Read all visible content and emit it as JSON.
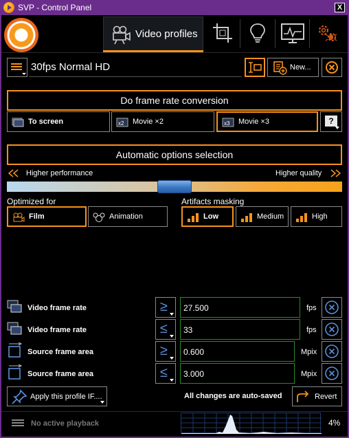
{
  "window": {
    "title": "SVP - Control Panel",
    "close_label": "X"
  },
  "toolbar": {
    "active_tab_label": "Video profiles",
    "tabs": [
      {
        "name": "video-profiles",
        "icon": "video-camera-icon"
      },
      {
        "name": "crop",
        "icon": "crop-icon"
      },
      {
        "name": "tips",
        "icon": "lightbulb-icon"
      },
      {
        "name": "monitor",
        "icon": "monitor-icon"
      },
      {
        "name": "settings",
        "icon": "gears-bug-icon"
      }
    ]
  },
  "profile": {
    "name": "30fps Normal HD",
    "new_label": "New...",
    "accent": "#f7921e"
  },
  "frame_rate": {
    "button_label": "Do frame rate conversion",
    "options": [
      {
        "label": "To screen",
        "selected": true
      },
      {
        "label": "Movie ×2",
        "selected": false
      },
      {
        "label": "Movie ×3",
        "selected": true
      }
    ],
    "help_label": "?"
  },
  "auto_options": {
    "button_label": "Automatic options selection",
    "left_label": "Higher performance",
    "right_label": "Higher quality",
    "slider_position_fraction": 0.5
  },
  "optimized_for": {
    "label": "Optimized for",
    "options": [
      {
        "label": "Film",
        "selected": true
      },
      {
        "label": "Animation",
        "selected": false
      }
    ]
  },
  "artifacts": {
    "label": "Artifacts masking",
    "options": [
      {
        "label": "Low",
        "selected": true
      },
      {
        "label": "Medium",
        "selected": false
      },
      {
        "label": "High",
        "selected": false
      }
    ]
  },
  "conditions": [
    {
      "label": "Video frame rate",
      "operator": "≥",
      "value": "27.500",
      "unit": "fps",
      "icon": "frames-icon"
    },
    {
      "label": "Video frame rate",
      "operator": "≤",
      "value": "33",
      "unit": "fps",
      "icon": "frames-icon"
    },
    {
      "label": "Source frame area",
      "operator": "≥",
      "value": "0.600",
      "unit": "Mpix",
      "icon": "frame-area-icon"
    },
    {
      "label": "Source frame area",
      "operator": "≤",
      "value": "3.000",
      "unit": "Mpix",
      "icon": "frame-area-icon"
    }
  ],
  "footer": {
    "apply_label": "Apply this profile IF....",
    "autosave_label": "All changes are auto-saved",
    "revert_label": "Revert"
  },
  "status": {
    "playback_label": "No active playback",
    "cpu_percent": "4%"
  }
}
